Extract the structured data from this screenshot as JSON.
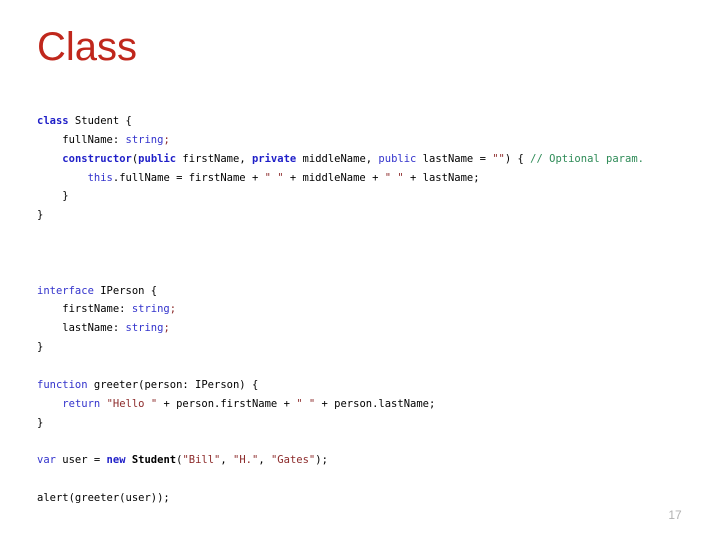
{
  "slide": {
    "title": "Class",
    "title_color": "#C0271C",
    "background_color": "#FFFFFF",
    "page_number": "17"
  },
  "theme": {
    "keyword_bold_color": "#1F1FC8",
    "keyword_color": "#3333CC",
    "type_color": "#3333CC",
    "string_color": "#8C2A2A",
    "comment_color": "#2E8B57",
    "text_color": "#000000",
    "page_number_color": "#B2B2B2"
  },
  "code": {
    "language": "typescript",
    "lines": [
      {
        "id": "line-1",
        "text": "class Student {",
        "tokens": [
          {
            "t": "class",
            "c": "kw"
          },
          {
            "t": " Student {",
            "c": "pn"
          }
        ]
      },
      {
        "id": "line-2",
        "text": "    fullName: string;",
        "tokens": [
          {
            "t": "    fullName: ",
            "c": "pn"
          },
          {
            "t": "string",
            "c": "typ"
          },
          {
            "t": ";",
            "c": "semi"
          }
        ]
      },
      {
        "id": "line-3",
        "text": "    constructor(public firstName, private middleName, public lastName = \"\") { // Optional param.",
        "tokens": [
          {
            "t": "    ",
            "c": "pn"
          },
          {
            "t": "constructor",
            "c": "kw"
          },
          {
            "t": "(",
            "c": "pn"
          },
          {
            "t": "public",
            "c": "kw"
          },
          {
            "t": " firstName, ",
            "c": "pn"
          },
          {
            "t": "private",
            "c": "kw"
          },
          {
            "t": " middleName, ",
            "c": "pn"
          },
          {
            "t": "public",
            "c": "kw-r"
          },
          {
            "t": " lastName = ",
            "c": "pn"
          },
          {
            "t": "\"\"",
            "c": "str"
          },
          {
            "t": ") { ",
            "c": "pn"
          },
          {
            "t": "// Optional param.",
            "c": "cmt"
          }
        ]
      },
      {
        "id": "line-4",
        "text": "        this.fullName = firstName + \" \" + middleName + \" \" + lastName;",
        "tokens": [
          {
            "t": "        ",
            "c": "pn"
          },
          {
            "t": "this",
            "c": "kw-r"
          },
          {
            "t": ".fullName = firstName + ",
            "c": "pn"
          },
          {
            "t": "\" \"",
            "c": "str"
          },
          {
            "t": " + middleName + ",
            "c": "pn"
          },
          {
            "t": "\" \"",
            "c": "str"
          },
          {
            "t": " + lastName;",
            "c": "pn"
          }
        ]
      },
      {
        "id": "line-5",
        "text": "    }",
        "tokens": [
          {
            "t": "    }",
            "c": "pn"
          }
        ]
      },
      {
        "id": "line-6",
        "text": "}",
        "tokens": [
          {
            "t": "}",
            "c": "pn"
          }
        ]
      },
      {
        "id": "line-7",
        "text": "",
        "tokens": []
      },
      {
        "id": "line-8",
        "text": "",
        "tokens": []
      },
      {
        "id": "line-9",
        "text": "",
        "tokens": []
      },
      {
        "id": "line-10",
        "text": "interface IPerson {",
        "tokens": [
          {
            "t": "interface",
            "c": "kw-r"
          },
          {
            "t": " IPerson {",
            "c": "pn"
          }
        ]
      },
      {
        "id": "line-11",
        "text": "    firstName: string;",
        "tokens": [
          {
            "t": "    firstName: ",
            "c": "pn"
          },
          {
            "t": "string",
            "c": "typ"
          },
          {
            "t": ";",
            "c": "semi"
          }
        ]
      },
      {
        "id": "line-12",
        "text": "    lastName: string;",
        "tokens": [
          {
            "t": "    lastName: ",
            "c": "pn"
          },
          {
            "t": "string",
            "c": "typ"
          },
          {
            "t": ";",
            "c": "semi"
          }
        ]
      },
      {
        "id": "line-13",
        "text": "}",
        "tokens": [
          {
            "t": "}",
            "c": "pn"
          }
        ]
      },
      {
        "id": "line-14",
        "text": "",
        "tokens": []
      },
      {
        "id": "line-15",
        "text": "function greeter(person: IPerson) {",
        "tokens": [
          {
            "t": "function",
            "c": "kw-r"
          },
          {
            "t": " greeter(person: IPerson) {",
            "c": "pn"
          }
        ]
      },
      {
        "id": "line-16",
        "text": "    return \"Hello \" + person.firstName + \" \" + person.lastName;",
        "tokens": [
          {
            "t": "    ",
            "c": "pn"
          },
          {
            "t": "return",
            "c": "kw-r"
          },
          {
            "t": " ",
            "c": "pn"
          },
          {
            "t": "\"Hello \"",
            "c": "str"
          },
          {
            "t": " + person.firstName + ",
            "c": "pn"
          },
          {
            "t": "\" \"",
            "c": "str"
          },
          {
            "t": " + person.lastName;",
            "c": "pn"
          }
        ]
      },
      {
        "id": "line-17",
        "text": "}",
        "tokens": [
          {
            "t": "}",
            "c": "pn"
          }
        ]
      },
      {
        "id": "line-18",
        "text": "",
        "tokens": []
      },
      {
        "id": "line-19",
        "text": "var user = new Student(\"Bill\", \"H.\", \"Gates\");",
        "tokens": [
          {
            "t": "var",
            "c": "kw-r"
          },
          {
            "t": " user = ",
            "c": "pn"
          },
          {
            "t": "new",
            "c": "kw"
          },
          {
            "t": " ",
            "c": "pn"
          },
          {
            "t": "Student",
            "c": "cls"
          },
          {
            "t": "(",
            "c": "pn"
          },
          {
            "t": "\"Bill\"",
            "c": "str"
          },
          {
            "t": ", ",
            "c": "pn"
          },
          {
            "t": "\"H.\"",
            "c": "str"
          },
          {
            "t": ", ",
            "c": "pn"
          },
          {
            "t": "\"Gates\"",
            "c": "str"
          },
          {
            "t": ");",
            "c": "pn"
          }
        ]
      },
      {
        "id": "line-20",
        "text": "",
        "tokens": []
      },
      {
        "id": "line-21",
        "text": "alert(greeter(user));",
        "tokens": [
          {
            "t": "alert(greeter(user));",
            "c": "pn"
          }
        ]
      }
    ]
  }
}
